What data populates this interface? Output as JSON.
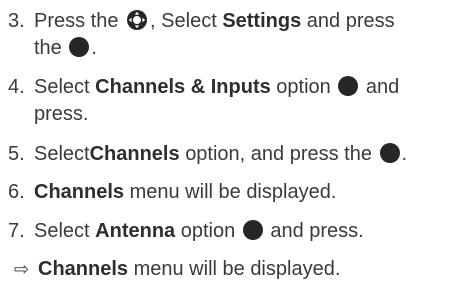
{
  "steps": [
    {
      "number": "3.",
      "parts": {
        "a": "Press the",
        "b": ", Select",
        "c": "Settings",
        "d": "and press",
        "e": "the",
        "f": "."
      }
    },
    {
      "number": "4.",
      "parts": {
        "a": "Select",
        "b": "Channels & Inputs",
        "c": "option",
        "d": "and",
        "e": "press."
      }
    },
    {
      "number": "5.",
      "parts": {
        "a": "Select",
        "b": "Channels",
        "c": "option, and press the",
        "d": "."
      }
    },
    {
      "number": "6.",
      "parts": {
        "a": "Channels",
        "b": "menu will be displayed."
      }
    },
    {
      "number": "7.",
      "parts": {
        "a": "Select",
        "b": "Antenna",
        "c": "option",
        "d": "and press."
      }
    }
  ],
  "result": {
    "arrow": "⇨",
    "bold": "Channels",
    "text": "menu will be displayed."
  },
  "icons": {
    "dpad": "dpad-icon",
    "ok": "ok-button-icon"
  },
  "colors": {
    "text": "#3a3a3a",
    "icon": "#262626"
  }
}
